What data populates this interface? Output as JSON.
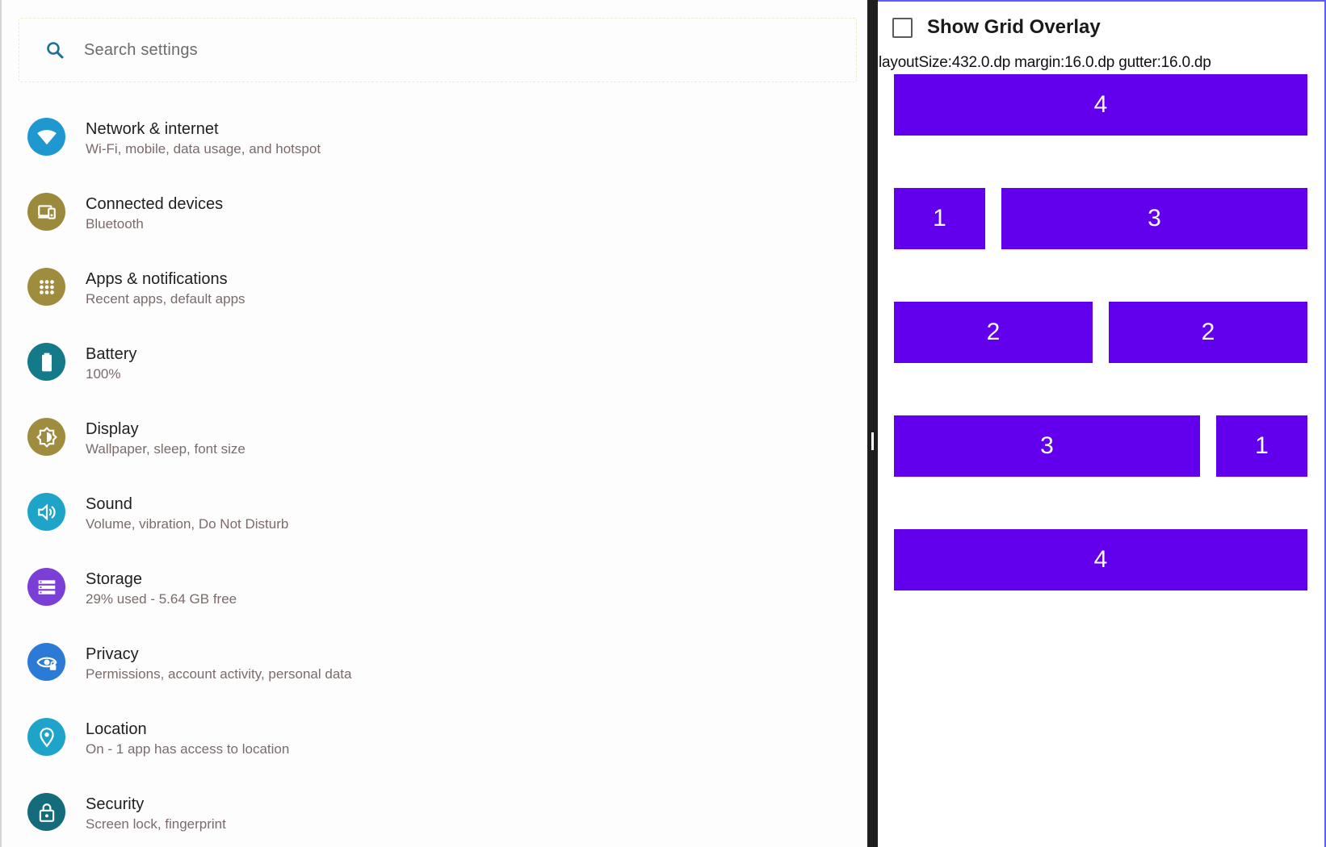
{
  "search": {
    "placeholder": "Search settings"
  },
  "settings": [
    {
      "title": "Network & internet",
      "subtitle": "Wi-Fi, mobile, data usage, and hotspot",
      "icon": "wifi-icon",
      "color": "#1f97cf"
    },
    {
      "title": "Connected devices",
      "subtitle": "Bluetooth",
      "icon": "devices-icon",
      "color": "#9b8a3c"
    },
    {
      "title": "Apps & notifications",
      "subtitle": "Recent apps, default apps",
      "icon": "apps-icon",
      "color": "#a08c3e"
    },
    {
      "title": "Battery",
      "subtitle": "100%",
      "icon": "battery-icon",
      "color": "#147a8a"
    },
    {
      "title": "Display",
      "subtitle": "Wallpaper, sleep, font size",
      "icon": "brightness-icon",
      "color": "#a08c3e"
    },
    {
      "title": "Sound",
      "subtitle": "Volume, vibration, Do Not Disturb",
      "icon": "volume-icon",
      "color": "#1da4c8"
    },
    {
      "title": "Storage",
      "subtitle": "29% used - 5.64 GB free",
      "icon": "storage-icon",
      "color": "#7b3fd8"
    },
    {
      "title": "Privacy",
      "subtitle": "Permissions, account activity, personal data",
      "icon": "privacy-eye-icon",
      "color": "#2a7ad6"
    },
    {
      "title": "Location",
      "subtitle": "On - 1 app has access to location",
      "icon": "location-icon",
      "color": "#1da4c8"
    },
    {
      "title": "Security",
      "subtitle": "Screen lock, fingerprint",
      "icon": "lock-icon",
      "color": "#146b7a"
    }
  ],
  "grid_demo": {
    "overlay_label": "Show Grid Overlay",
    "overlay_checked": false,
    "layout_info": "layoutSize:432.0.dp margin:16.0.dp gutter:16.0.dp",
    "block_color": "#6200ee",
    "rows": [
      [
        "4"
      ],
      [
        "1",
        "3"
      ],
      [
        "2",
        "2"
      ],
      [
        "3",
        "1"
      ],
      [
        "4"
      ]
    ]
  }
}
